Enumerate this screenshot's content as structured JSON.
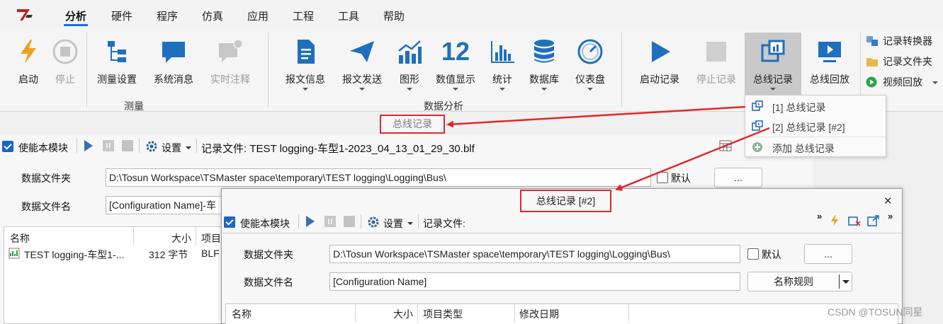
{
  "menu": {
    "items": [
      "分析",
      "硬件",
      "程序",
      "仿真",
      "应用",
      "工程",
      "工具",
      "帮助"
    ],
    "active": "分析"
  },
  "ribbon": {
    "buttons": [
      "启动",
      "停止",
      "测量设置",
      "系统消息",
      "实时注释",
      "报文信息",
      "报文发送",
      "图形",
      "数值显示",
      "统计",
      "数据库",
      "仪表盘",
      "启动记录",
      "停止记录",
      "总线记录",
      "总线回放"
    ],
    "numeric_icon_text": "12",
    "groups": [
      "测量",
      "数据分析"
    ],
    "side_buttons": [
      "记录转换器",
      "记录文件夹",
      "视频回放"
    ]
  },
  "popup": {
    "items": [
      "[1] 总线记录",
      "[2] 总线记录 [#2]",
      "添加 总线记录"
    ]
  },
  "panel1": {
    "tab_title": "总线记录",
    "enable_module": "使能本模块",
    "settings_label": "设置",
    "record_file_label": "记录文件: TEST logging-车型1-2023_04_13_01_29_30.blf",
    "data_folder_label": "数据文件夹",
    "data_folder_value": "D:\\Tosun Workspace\\TSMaster space\\temporary\\TEST logging\\Logging\\Bus\\",
    "default_label": "默认",
    "browse_label": "...",
    "data_filename_label": "数据文件名",
    "data_filename_value": "[Configuration Name]-车",
    "columns": [
      "名称",
      "大小",
      "项目"
    ],
    "rows": [
      {
        "name": "TEST logging-车型1-...",
        "size": "312 字节",
        "type": "BLF"
      }
    ]
  },
  "window2": {
    "title": "总线记录 [#2]",
    "close_label": "✕",
    "enable_module": "使能本模块",
    "settings_label": "设置",
    "record_file_label": "记录文件:",
    "data_folder_label": "数据文件夹",
    "data_folder_value": "D:\\Tosun Workspace\\TSMaster space\\temporary\\TEST logging\\Logging\\Bus\\",
    "default_label": "默认",
    "browse_label": "...",
    "data_filename_label": "数据文件名",
    "data_filename_value": "[Configuration Name]",
    "naming_rule_label": "名称规则",
    "columns": [
      "名称",
      "大小",
      "项目类型",
      "修改日期"
    ]
  },
  "watermark": "CSDN @TOSUN同星",
  "colors": {
    "accent_blue": "#1b64c8",
    "icon_blue": "#1f6fbf",
    "highlight_red": "#e02828",
    "lightning_orange": "#f0a020"
  }
}
